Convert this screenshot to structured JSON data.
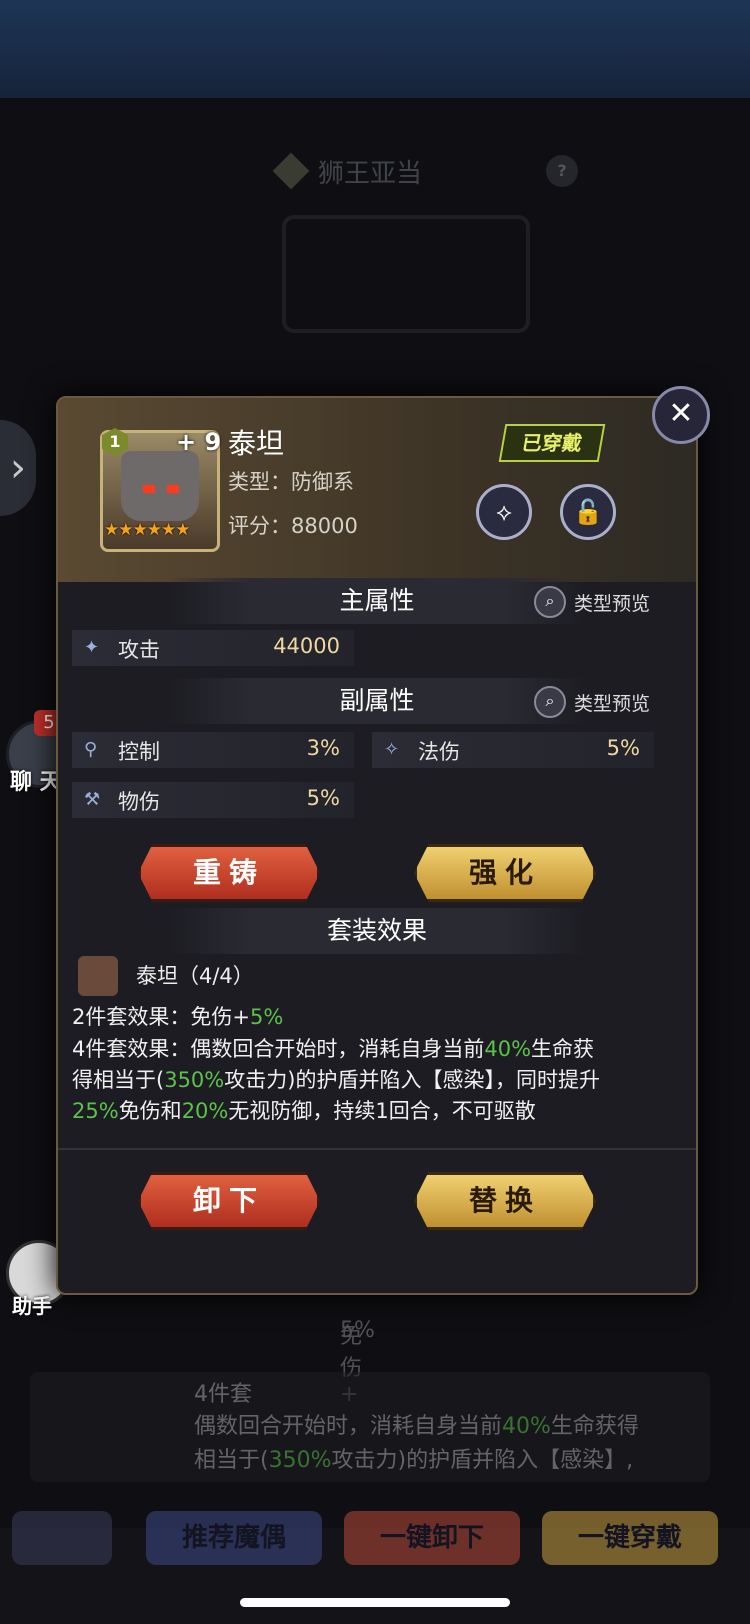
{
  "background": {
    "title": "狮王亚当",
    "help_icon": "?",
    "side_arrow": "›",
    "chat_badge": "5",
    "chat_label": "聊 天",
    "helper_label": "助手",
    "row_text_prefix": "免伤+",
    "row_text_value": "5%",
    "card_title": "4件套",
    "card_line1_a": "偶数回合开始时，消耗自身当前",
    "card_line1_g": "40%",
    "card_line1_b": "生命获得",
    "card_line2_a": "相当于(",
    "card_line2_g": "350%",
    "card_line2_b": "攻击力)的护盾并陷入【感染】,",
    "bottom_buttons": [
      "推荐魔偶",
      "一键卸下",
      "一键穿戴"
    ]
  },
  "popup": {
    "close_icon": "✕",
    "item": {
      "level": "1",
      "plus": "+ 9",
      "stars": "★★★★★★",
      "name": "泰坦",
      "type_label": "类型：防御系",
      "score_label": "评分：88000",
      "equipped_badge": "已穿戴"
    },
    "main_attr": {
      "title": "主属性",
      "preview_label": "类型预览",
      "stats": [
        {
          "label": "攻击",
          "value": "44000"
        }
      ]
    },
    "sub_attr": {
      "title": "副属性",
      "preview_label": "类型预览",
      "stats": [
        {
          "label": "控制",
          "value": "3%"
        },
        {
          "label": "法伤",
          "value": "5%"
        },
        {
          "label": "物伤",
          "value": "5%"
        }
      ]
    },
    "buttons": {
      "recast": "重铸",
      "enhance": "强化",
      "unequip": "卸下",
      "replace": "替换"
    },
    "set_effect": {
      "title": "套装效果",
      "set_name": "泰坦（4/4）",
      "two_piece_prefix": "2件套效果：免伤+",
      "two_piece_value": "5%",
      "four_piece_l1_a": "4件套效果：偶数回合开始时，消耗自身当前",
      "four_piece_l1_g": "40%",
      "four_piece_l1_b": "生命获",
      "four_piece_l2_a": "得相当于(",
      "four_piece_l2_g": "350%",
      "four_piece_l2_b": "攻击力)的护盾并陷入【感染】，同时提升",
      "four_piece_l3_g1": "25%",
      "four_piece_l3_a": "免伤和",
      "four_piece_l3_g2": "20%",
      "four_piece_l3_b": "无视防御，持续1回合，不可驱散"
    }
  },
  "colors": {
    "highlight_green": "#5bc24a",
    "equipped_badge": "#e6f06a",
    "star": "#f4a21a"
  }
}
